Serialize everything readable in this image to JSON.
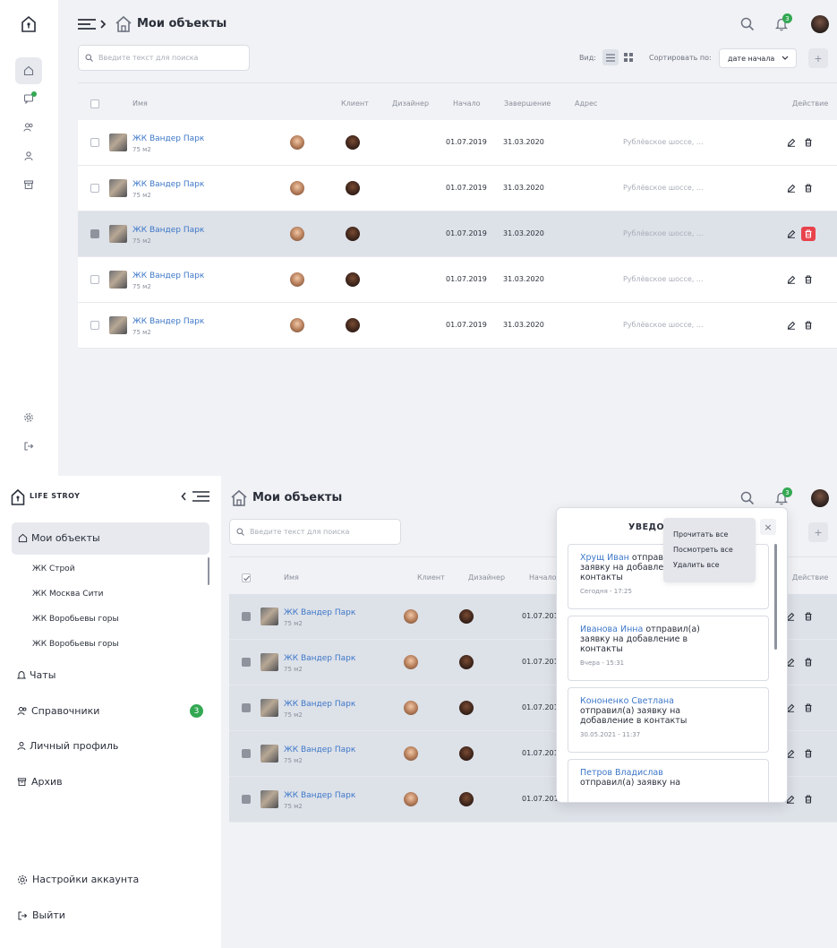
{
  "brand": {
    "name": "LIFE STROY"
  },
  "header": {
    "title": "Мои объекты",
    "notifications_count": "3"
  },
  "search": {
    "placeholder": "Введите текст для поиска"
  },
  "toolbar": {
    "view_label": "Вид:",
    "sort_label": "Сортировать по:",
    "sort_value": "дате начала",
    "add_label": "+"
  },
  "table": {
    "headers": {
      "name": "Имя",
      "client": "Клиент",
      "designer": "Дизайнер",
      "start": "Начало",
      "end": "Завершение",
      "address": "Адрес",
      "actions": "Действие"
    },
    "rows": [
      {
        "name": "ЖК Вандер Парк",
        "area": "75 м2",
        "start": "01.07.2019",
        "end": "31.03.2020",
        "address": "Рублёвское шоссе, ..."
      },
      {
        "name": "ЖК Вандер Парк",
        "area": "75 м2",
        "start": "01.07.2019",
        "end": "31.03.2020",
        "address": "Рублёвское шоссе, ..."
      },
      {
        "name": "ЖК Вандер Парк",
        "area": "75 м2",
        "start": "01.07.2019",
        "end": "31.03.2020",
        "address": "Рублёвское шоссе, ..."
      },
      {
        "name": "ЖК Вандер Парк",
        "area": "75 м2",
        "start": "01.07.2019",
        "end": "31.03.2020",
        "address": "Рублёвское шоссе, ..."
      },
      {
        "name": "ЖК Вандер Парк",
        "area": "75 м2",
        "start": "01.07.2019",
        "end": "31.03.2020",
        "address": "Рублёвское шоссе, ..."
      }
    ]
  },
  "sidebar": {
    "my_objects": "Мои объекты",
    "sub_items": [
      "ЖК Строй",
      "ЖК Москва Сити",
      "ЖК Воробьевы горы",
      "ЖК Воробьевы горы"
    ],
    "chats": "Чаты",
    "directories": "Справочники",
    "directories_badge": "3",
    "profile": "Личный профиль",
    "archive": "Архив",
    "settings": "Настройки аккаунта",
    "logout": "Выйти"
  },
  "notifications": {
    "title": "УВЕДОМ",
    "menu": [
      "Прочитать все",
      "Посмотреть все",
      "Удалить все"
    ],
    "close_label": "×",
    "items": [
      {
        "who": "Хрущ Иван",
        "text": "отправи",
        "text2": "заявку на добавлени",
        "text3": "контакты",
        "time": "Сегодня - 17:25"
      },
      {
        "who": "Иванова Инна",
        "text": "отправил(а)",
        "text2": "заявку на добавление в",
        "text3": "контакты",
        "time": "Вчера - 15:31"
      },
      {
        "who": "Кононенко Светлана",
        "text": "",
        "text2": "отправил(а) заявку на",
        "text3": "добавление в контакты",
        "time": "30.05.2021 - 11:37"
      },
      {
        "who": "Петров Владислав",
        "text": "",
        "text2": "отправил(а) заявку на",
        "text3": "",
        "time": ""
      }
    ]
  },
  "colors": {
    "accent": "#3d77c8",
    "danger": "#e8424c",
    "success": "#33a853",
    "bg": "#f1f2f5"
  }
}
